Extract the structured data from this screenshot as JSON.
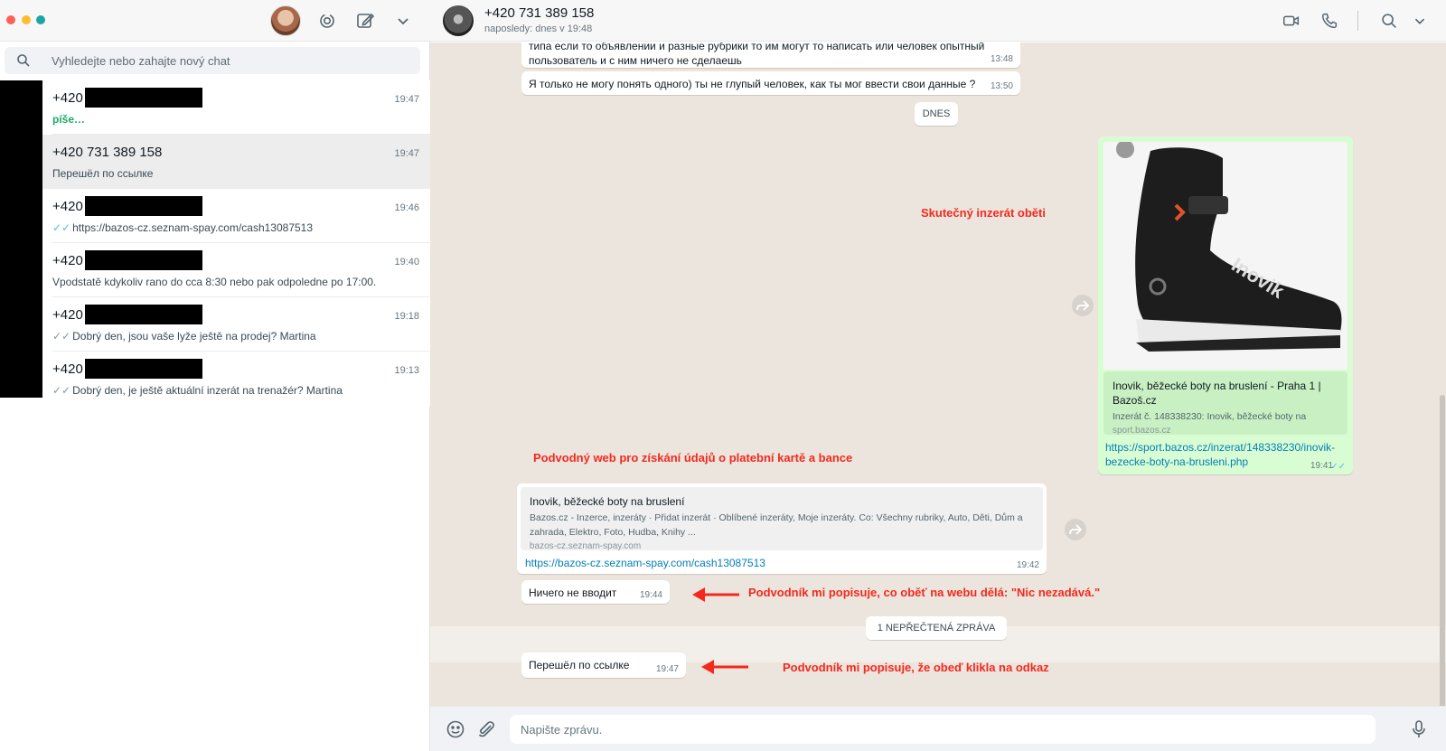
{
  "sidebar": {
    "search_placeholder": "Vyhledejte nebo zahajte nový chat",
    "chats": [
      {
        "name": "+420",
        "time": "19:47",
        "preview": "píše…",
        "typing": true,
        "ticks": "",
        "redacted": true
      },
      {
        "name": "+420 731 389 158",
        "time": "19:47",
        "preview": "Перешёл по ссылке",
        "typing": false,
        "ticks": "",
        "redacted": false
      },
      {
        "name": "+420",
        "time": "19:46",
        "preview": "https://bazos-cz.seznam-spay.com/cash13087513",
        "typing": false,
        "ticks": "✓✓",
        "redacted": true
      },
      {
        "name": "+420",
        "time": "19:40",
        "preview": "Vpodstatě kdykoliv rano do cca 8:30 nebo pak odpoledne po 17:00.",
        "typing": false,
        "ticks": "",
        "redacted": true
      },
      {
        "name": "+420",
        "time": "19:18",
        "preview": "Dobrý den, jsou vaše lyže ještě na prodej? Martina",
        "typing": false,
        "ticks": "✓✓",
        "redacted": true
      },
      {
        "name": "+420",
        "time": "19:13",
        "preview": "Dobrý den, je ještě aktuální inzerát na trenažér? Martina",
        "typing": false,
        "ticks": "✓✓",
        "redacted": true
      }
    ]
  },
  "header": {
    "contact_name": "+420 731 389 158",
    "status": "naposledy: dnes v 19:48"
  },
  "messages": {
    "m1_text_line1": "типа если то объявлении и разные рубрики то им могут то написать или человек опытный",
    "m1_text_line2": "пользователь и с ним ничего не сделаешь",
    "m1_time": "13:48",
    "m2_text": "Я только не могу понять одного) ты не глупый человек, как ты мог ввести свои данные ?",
    "m2_time": "13:50",
    "day_chip": "DNES",
    "out_preview_title": "Inovik, běžecké boty na bruslení - Praha 1 | Bazoš.cz",
    "out_preview_desc": "Inzerát č. 148338230: Inovik, běžecké boty na",
    "out_preview_domain": "sport.bazos.cz",
    "out_link": "https://sport.bazos.cz/inzerat/148338230/inovik-bezecke-boty-na-brusleni.php",
    "out_time": "19:41",
    "out_ticks": "✓✓",
    "in_preview_title": "Inovik, běžecké boty na bruslení",
    "in_preview_desc": "Bazos.cz - Inzerce, inzeráty · Přidat inzerát · Oblíbené inzeráty, Moje inzeráty. Co: Všechny rubriky, Auto, Děti, Dům a zahrada, Elektro, Foto, Hudba, Knihy ...",
    "in_preview_domain": "bazos-cz.seznam-spay.com",
    "in_link": "https://bazos-cz.seznam-spay.com/cash13087513",
    "in_link_time": "19:42",
    "m_nothing_text": "Ничего не вводит",
    "m_nothing_time": "19:44",
    "unread_chip": "1 NEPŘEČTENÁ ZPRÁVA",
    "m_last_text": "Перешёл по ссылке",
    "m_last_time": "19:47",
    "photo_watermark": "Inovik"
  },
  "annotations": {
    "real_ad": "Skutečný inzerát oběti",
    "fraud_web": "Podvodný web pro získání údajů o platební kartě a bance",
    "describes": "Podvodník mi popisuje, co oběť na webu dělá: \"Nic nezadává.\"",
    "clicked": "Podvodník mi popisuje, že obeď klikla na odkaz"
  },
  "composer": {
    "placeholder": "Napište zprávu."
  },
  "colors": {
    "annotation": "#f4291e",
    "outgoing_bubble": "#d9fdd3",
    "link": "#027eb5",
    "typing": "#1daa61"
  }
}
